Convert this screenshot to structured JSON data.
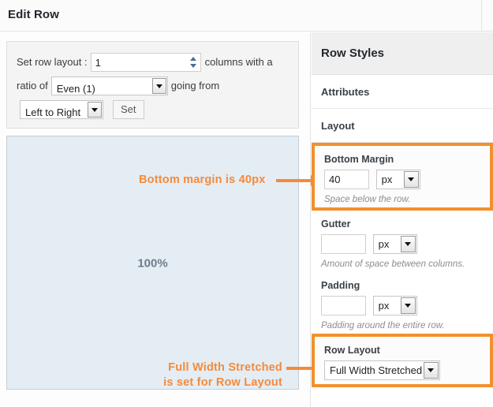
{
  "header": {
    "title": "Edit Row"
  },
  "row_layout_form": {
    "label_prefix": "Set row layout :",
    "columns_value": "1",
    "label_columns_with_a": "columns with a",
    "label_ratio_of": "ratio of",
    "ratio_value": "Even (1)",
    "label_going_from": "going from",
    "direction_value": "Left to Right",
    "set_button": "Set"
  },
  "row_preview": {
    "width_label": "100%"
  },
  "annotations": [
    {
      "text": "Bottom margin is 40px"
    },
    {
      "line1": "Full Width Stretched",
      "line2": "is set for Row Layout"
    }
  ],
  "sidebar": {
    "title": "Row Styles",
    "sections": [
      {
        "label": "Attributes"
      },
      {
        "label": "Layout"
      }
    ],
    "fields": {
      "bottom_margin": {
        "label": "Bottom Margin",
        "value": "40",
        "unit": "px",
        "hint": "Space below the row."
      },
      "gutter": {
        "label": "Gutter",
        "value": "",
        "unit": "px",
        "hint": "Amount of space between columns."
      },
      "padding": {
        "label": "Padding",
        "value": "",
        "unit": "px",
        "hint": "Padding around the entire row."
      },
      "row_layout": {
        "label": "Row Layout",
        "value": "Full Width Stretched"
      }
    }
  },
  "colors": {
    "highlight": "#f0912d",
    "annotation": "#f58a3c",
    "preview_bg": "#e4edf3"
  }
}
